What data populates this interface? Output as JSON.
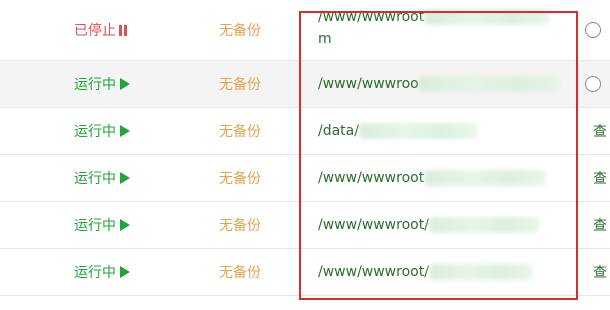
{
  "rows": [
    {
      "status": "已停止",
      "backup": "无备份",
      "path": "/www/wwwroot",
      "path_tail": "m",
      "action": ""
    },
    {
      "status": "运行中",
      "backup": "无备份",
      "path": "/www/wwwroo",
      "path_tail": "",
      "action": ""
    },
    {
      "status": "运行中",
      "backup": "无备份",
      "path": "/data/",
      "path_tail": "",
      "action": "查"
    },
    {
      "status": "运行中",
      "backup": "无备份",
      "path": "/www/wwwroot",
      "path_tail": "",
      "action": "查"
    },
    {
      "status": "运行中",
      "backup": "无备份",
      "path": "/www/wwwroot/",
      "path_tail": "",
      "action": "查"
    },
    {
      "status": "运行中",
      "backup": "无备份",
      "path": "/www/wwwroot/",
      "path_tail": "",
      "action": "查"
    }
  ],
  "colors": {
    "stopped": "#d9534f",
    "running": "#20a53a",
    "backup": "#e3a44f",
    "path": "#2c6d2e",
    "highlight": "#dd2b2b"
  },
  "icons": {
    "stopped": "pause-icon",
    "running": "play-icon"
  }
}
